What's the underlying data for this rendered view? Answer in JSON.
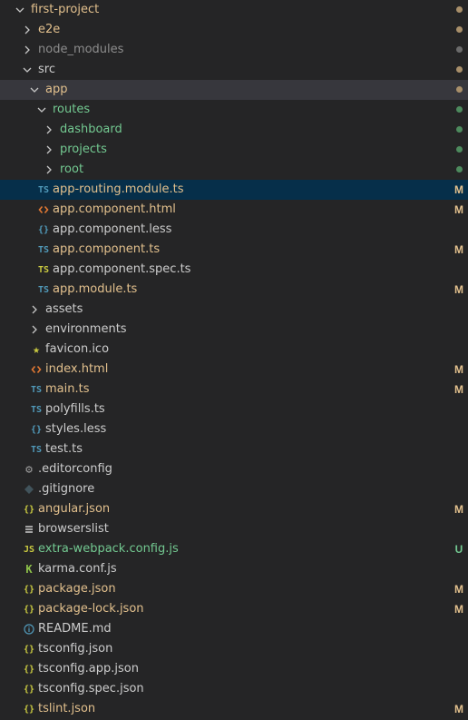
{
  "colors": {
    "background": "#252526",
    "row_selected": "#062f4a",
    "row_active": "#37373d",
    "text_default": "#cccccc",
    "text_ignored": "#8c8c8c",
    "text_modified": "#e2c08d",
    "text_untracked": "#73c991",
    "dot_modified": "#a88f6a",
    "dot_folder_gray": "#6b6b6b",
    "dot_untracked": "#4d8a5d",
    "chevron": "#c5c5c5",
    "indent_guide": "#585858",
    "icon_ts": "#519aba",
    "icon_html": "#e37933",
    "icon_json": "#cbcb41",
    "icon_less": "#519aba",
    "icon_js": "#cbcb41",
    "icon_star": "#cbcb41",
    "icon_info": "#519aba",
    "icon_karma": "#8dc149",
    "icon_gear": "#9a9a9a",
    "icon_git": "#41535b"
  },
  "items": [
    {
      "name": "first-project",
      "type": "folder",
      "open": true,
      "depth": 0,
      "status": "modified",
      "decoration": "dot"
    },
    {
      "name": "e2e",
      "type": "folder",
      "open": false,
      "depth": 1,
      "status": "modified",
      "decoration": "dot"
    },
    {
      "name": "node_modules",
      "type": "folder",
      "open": false,
      "depth": 1,
      "status": "ignored",
      "decoration": "dot-gray"
    },
    {
      "name": "src",
      "type": "folder",
      "open": true,
      "depth": 1,
      "status": "default",
      "decoration": "dot"
    },
    {
      "name": "app",
      "type": "folder",
      "open": true,
      "depth": 2,
      "status": "modified",
      "decoration": "dot",
      "active": true
    },
    {
      "name": "routes",
      "type": "folder",
      "open": true,
      "depth": 3,
      "status": "untracked",
      "decoration": "dot-green"
    },
    {
      "name": "dashboard",
      "type": "folder",
      "open": false,
      "depth": 4,
      "status": "untracked",
      "decoration": "dot-green"
    },
    {
      "name": "projects",
      "type": "folder",
      "open": false,
      "depth": 4,
      "status": "untracked",
      "decoration": "dot-green"
    },
    {
      "name": "root",
      "type": "folder",
      "open": false,
      "depth": 4,
      "status": "untracked",
      "decoration": "dot-green"
    },
    {
      "name": "app-routing.module.ts",
      "type": "file",
      "icon": "ts",
      "depth": 3,
      "status": "modified",
      "decoration": "M",
      "selected": true
    },
    {
      "name": "app.component.html",
      "type": "file",
      "icon": "html",
      "depth": 3,
      "status": "modified",
      "decoration": "M"
    },
    {
      "name": "app.component.less",
      "type": "file",
      "icon": "less",
      "depth": 3,
      "status": "default",
      "decoration": ""
    },
    {
      "name": "app.component.ts",
      "type": "file",
      "icon": "ts",
      "depth": 3,
      "status": "modified",
      "decoration": "M"
    },
    {
      "name": "app.component.spec.ts",
      "type": "file",
      "icon": "ts-spec",
      "depth": 3,
      "status": "default",
      "decoration": ""
    },
    {
      "name": "app.module.ts",
      "type": "file",
      "icon": "ts",
      "depth": 3,
      "status": "modified",
      "decoration": "M"
    },
    {
      "name": "assets",
      "type": "folder",
      "open": false,
      "depth": 2,
      "status": "default",
      "decoration": ""
    },
    {
      "name": "environments",
      "type": "folder",
      "open": false,
      "depth": 2,
      "status": "default",
      "decoration": ""
    },
    {
      "name": "favicon.ico",
      "type": "file",
      "icon": "star",
      "depth": 2,
      "status": "default",
      "decoration": ""
    },
    {
      "name": "index.html",
      "type": "file",
      "icon": "html",
      "depth": 2,
      "status": "modified",
      "decoration": "M"
    },
    {
      "name": "main.ts",
      "type": "file",
      "icon": "ts",
      "depth": 2,
      "status": "modified",
      "decoration": "M"
    },
    {
      "name": "polyfills.ts",
      "type": "file",
      "icon": "ts",
      "depth": 2,
      "status": "default",
      "decoration": ""
    },
    {
      "name": "styles.less",
      "type": "file",
      "icon": "less",
      "depth": 2,
      "status": "default",
      "decoration": ""
    },
    {
      "name": "test.ts",
      "type": "file",
      "icon": "ts",
      "depth": 2,
      "status": "default",
      "decoration": ""
    },
    {
      "name": ".editorconfig",
      "type": "file",
      "icon": "gear",
      "depth": 1,
      "status": "default",
      "decoration": ""
    },
    {
      "name": ".gitignore",
      "type": "file",
      "icon": "git",
      "depth": 1,
      "status": "default",
      "decoration": ""
    },
    {
      "name": "angular.json",
      "type": "file",
      "icon": "json",
      "depth": 1,
      "status": "modified",
      "decoration": "M"
    },
    {
      "name": "browserslist",
      "type": "file",
      "icon": "lines",
      "depth": 1,
      "status": "default",
      "decoration": ""
    },
    {
      "name": "extra-webpack.config.js",
      "type": "file",
      "icon": "js",
      "depth": 1,
      "status": "untracked",
      "decoration": "U"
    },
    {
      "name": "karma.conf.js",
      "type": "file",
      "icon": "karma",
      "depth": 1,
      "status": "default",
      "decoration": ""
    },
    {
      "name": "package.json",
      "type": "file",
      "icon": "json",
      "depth": 1,
      "status": "modified",
      "decoration": "M"
    },
    {
      "name": "package-lock.json",
      "type": "file",
      "icon": "json",
      "depth": 1,
      "status": "modified",
      "decoration": "M"
    },
    {
      "name": "README.md",
      "type": "file",
      "icon": "info",
      "depth": 1,
      "status": "default",
      "decoration": ""
    },
    {
      "name": "tsconfig.json",
      "type": "file",
      "icon": "json",
      "depth": 1,
      "status": "default",
      "decoration": ""
    },
    {
      "name": "tsconfig.app.json",
      "type": "file",
      "icon": "json",
      "depth": 1,
      "status": "default",
      "decoration": ""
    },
    {
      "name": "tsconfig.spec.json",
      "type": "file",
      "icon": "json",
      "depth": 1,
      "status": "default",
      "decoration": ""
    },
    {
      "name": "tslint.json",
      "type": "file",
      "icon": "json",
      "depth": 1,
      "status": "modified",
      "decoration": "M"
    }
  ]
}
